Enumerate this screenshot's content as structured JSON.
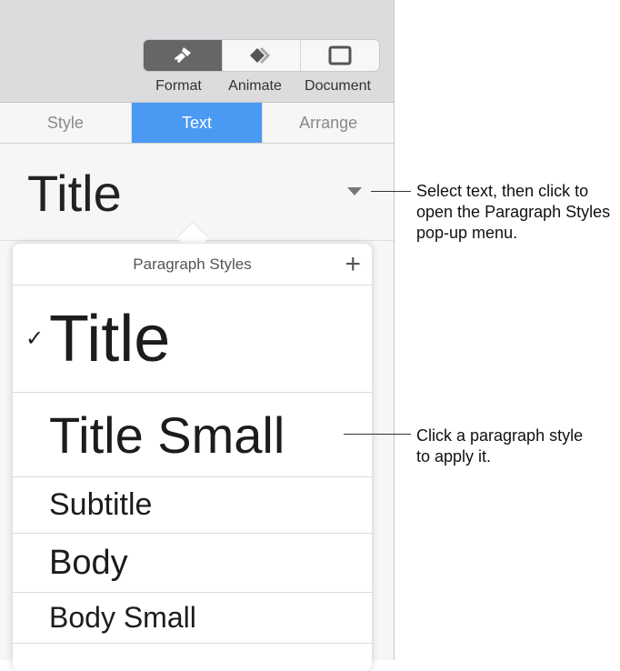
{
  "toolbar": {
    "buttons": [
      {
        "label": "Format",
        "icon": "paintbrush-icon",
        "active": true
      },
      {
        "label": "Animate",
        "icon": "animate-diamond-icon"
      },
      {
        "label": "Document",
        "icon": "document-icon"
      }
    ]
  },
  "tabs": [
    {
      "label": "Style"
    },
    {
      "label": "Text",
      "active": true
    },
    {
      "label": "Arrange"
    }
  ],
  "current_style": "Title",
  "popover": {
    "title": "Paragraph Styles",
    "add": "+",
    "check": "✓",
    "items": [
      {
        "label": "Title",
        "selected": true
      },
      {
        "label": "Title Small"
      },
      {
        "label": "Subtitle"
      },
      {
        "label": "Body"
      },
      {
        "label": "Body Small"
      }
    ]
  },
  "callouts": [
    "Select text, then click to open the Paragraph Styles pop-up menu.",
    "Click a paragraph style to apply it."
  ],
  "colors": {
    "accent": "#4a9af4",
    "active_button": "#666666"
  }
}
